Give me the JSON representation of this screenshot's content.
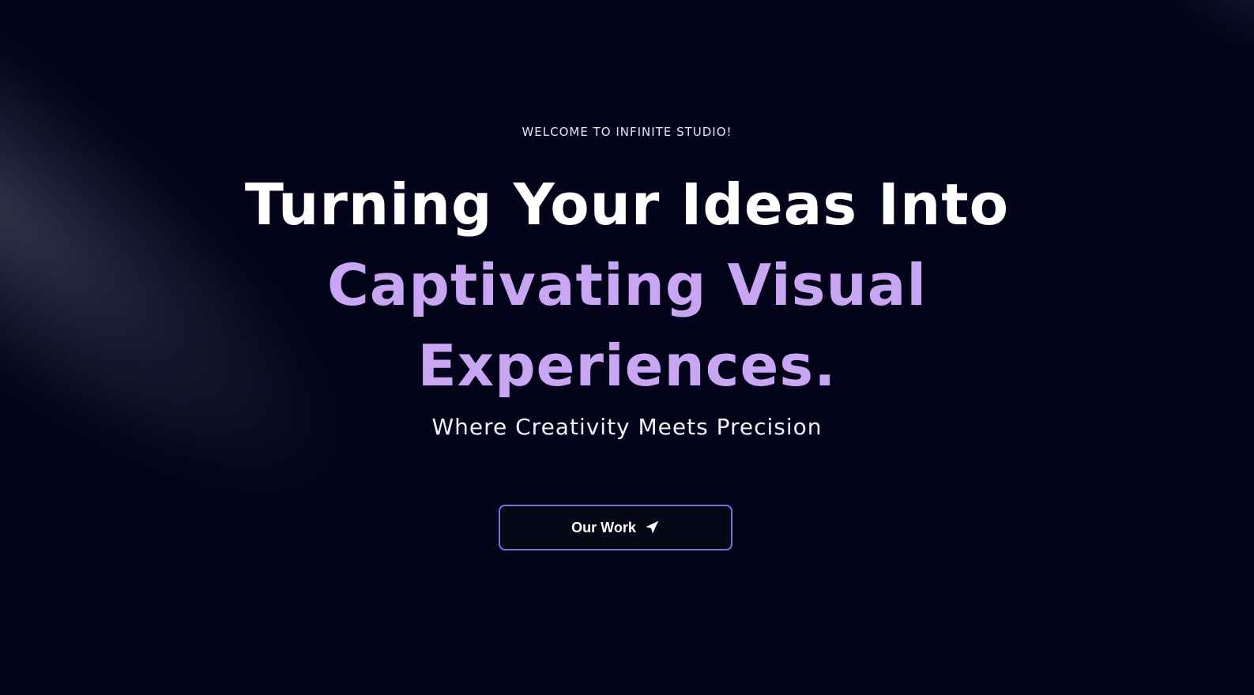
{
  "hero": {
    "eyebrow": "WELCOME TO INFINITE STUDIO!",
    "headline_line1": "Turning Your Ideas Into",
    "headline_line2": "Captivating Visual",
    "headline_line3": "Experiences.",
    "tagline": "Where Creativity Meets Precision"
  },
  "cta": {
    "label": "Our Work",
    "icon": "send-icon"
  },
  "colors": {
    "background": "#03031a",
    "accent": "#c8a6f4",
    "button_border": "#7c6fd6",
    "text": "#ffffff"
  }
}
